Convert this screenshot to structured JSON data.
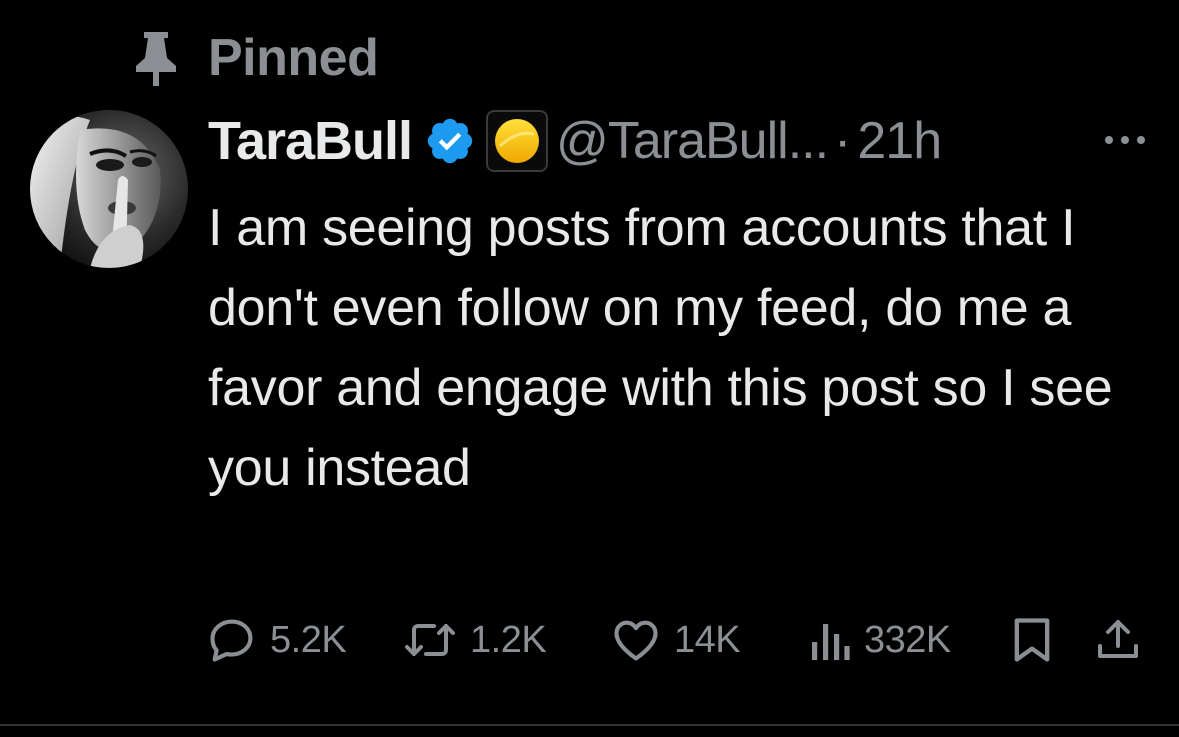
{
  "pinned": {
    "label": "Pinned",
    "icon": "pin-icon"
  },
  "post": {
    "display_name": "TaraBull",
    "verified_icon": "verified-badge-icon",
    "affiliate_icon": "affiliate-badge-icon",
    "handle": "@TaraBull...",
    "separator": "·",
    "time": "21h",
    "more_icon": "more-options-icon",
    "text": "I am seeing posts from accounts that I don't even follow on my feed, do me a favor and engage with this post so I see you instead",
    "accent_color": "#1d9bf0",
    "muted_color": "#8b8f94"
  },
  "actions": {
    "replies": {
      "icon": "reply-icon",
      "count": "5.2K"
    },
    "reposts": {
      "icon": "repost-icon",
      "count": "1.2K"
    },
    "likes": {
      "icon": "heart-icon",
      "count": "14K"
    },
    "views": {
      "icon": "views-icon",
      "count": "332K"
    },
    "bookmark": {
      "icon": "bookmark-icon"
    },
    "share": {
      "icon": "share-icon"
    }
  }
}
